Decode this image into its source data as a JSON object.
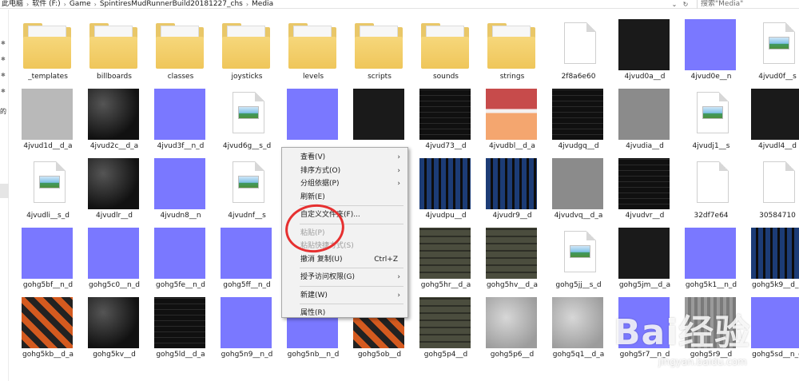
{
  "address_bar": {
    "crumbs": [
      "此电脑",
      "软件 (F:)",
      "Game",
      "SpintiresMudRunnerBuild20181227_chs",
      "Media"
    ],
    "separator": "›",
    "search_placeholder": "搜索\"Media\""
  },
  "nav": {
    "partial_text": "的"
  },
  "files": [
    {
      "name": "_templates",
      "kind": "folder"
    },
    {
      "name": "billboards",
      "kind": "folder"
    },
    {
      "name": "classes",
      "kind": "folder"
    },
    {
      "name": "joysticks",
      "kind": "folder"
    },
    {
      "name": "levels",
      "kind": "folder"
    },
    {
      "name": "scripts",
      "kind": "folder"
    },
    {
      "name": "sounds",
      "kind": "folder"
    },
    {
      "name": "strings",
      "kind": "folder"
    },
    {
      "name": "2f8a6e60",
      "kind": "blank"
    },
    {
      "name": "4jvud0a__d",
      "kind": "dark"
    },
    {
      "name": "4jvud0e__n",
      "kind": "blue"
    },
    {
      "name": "4jvud0f__s",
      "kind": "image"
    },
    {
      "name": "4jvud1d__d_a",
      "kind": "lgray"
    },
    {
      "name": "4jvud2c__d_a",
      "kind": "dark2"
    },
    {
      "name": "4jvud3f__n_d",
      "kind": "blue"
    },
    {
      "name": "4jvud6g__s_d",
      "kind": "image"
    },
    {
      "name": "",
      "kind": "blue"
    },
    {
      "name": "",
      "kind": "dark"
    },
    {
      "name": "4jvud73__d",
      "kind": "dark3"
    },
    {
      "name": "4jvudbl__d_a",
      "kind": "peach"
    },
    {
      "name": "4jvudgq__d",
      "kind": "dark3"
    },
    {
      "name": "4jvudia__d",
      "kind": "gray"
    },
    {
      "name": "4jvudj1__s",
      "kind": "image"
    },
    {
      "name": "4jvudl4__d",
      "kind": "dark"
    },
    {
      "name": "4jvudli__s_d",
      "kind": "image"
    },
    {
      "name": "4jvudlr__d",
      "kind": "dark2"
    },
    {
      "name": "4jvudn8__n",
      "kind": "blue"
    },
    {
      "name": "4jvudnf__s",
      "kind": "image"
    },
    {
      "name": "",
      "kind": "none"
    },
    {
      "name": "",
      "kind": "none"
    },
    {
      "name": "4jvudpu__d",
      "kind": "bluemap"
    },
    {
      "name": "4jvudr9__d",
      "kind": "bluemap"
    },
    {
      "name": "4jvudvq__d_a",
      "kind": "gray"
    },
    {
      "name": "4jvudvr__d",
      "kind": "dark3"
    },
    {
      "name": "32df7e64",
      "kind": "blank"
    },
    {
      "name": "30584710",
      "kind": "blank"
    },
    {
      "name": "gohg5bf__n_d",
      "kind": "blue"
    },
    {
      "name": "gohg5c0__n_d",
      "kind": "blue"
    },
    {
      "name": "gohg5fe__n_d",
      "kind": "blue"
    },
    {
      "name": "gohg5ff__n_d",
      "kind": "blue"
    },
    {
      "name": "",
      "kind": "none"
    },
    {
      "name": "",
      "kind": "none"
    },
    {
      "name": "gohg5hr__d_a",
      "kind": "olive"
    },
    {
      "name": "gohg5hv__d_a",
      "kind": "olive"
    },
    {
      "name": "gohg5jj__s_d",
      "kind": "image"
    },
    {
      "name": "gohg5jm__d_a",
      "kind": "dark"
    },
    {
      "name": "gohg5k1__n_d",
      "kind": "blue"
    },
    {
      "name": "gohg5k9__d_a",
      "kind": "bluemap"
    },
    {
      "name": "gohg5kb__d_a",
      "kind": "orange"
    },
    {
      "name": "gohg5kv__d",
      "kind": "dark2"
    },
    {
      "name": "gohg5ld__d_a",
      "kind": "dark3"
    },
    {
      "name": "gohg5n9__n_d",
      "kind": "blue"
    },
    {
      "name": "gohg5nb__n_d",
      "kind": "blue"
    },
    {
      "name": "gohg5ob__d",
      "kind": "orange"
    },
    {
      "name": "gohg5p4__d",
      "kind": "olive"
    },
    {
      "name": "gohg5p6__d",
      "kind": "stone"
    },
    {
      "name": "gohg5q1__d_a",
      "kind": "stone"
    },
    {
      "name": "gohg5r7__n_d",
      "kind": "blue"
    },
    {
      "name": "gohg5r9__d",
      "kind": "vein"
    },
    {
      "name": "gohg5sd__n_d",
      "kind": "blue"
    }
  ],
  "context_menu": {
    "items": [
      {
        "label": "查看(V)",
        "submenu": true,
        "disabled": false
      },
      {
        "label": "排序方式(O)",
        "submenu": true,
        "disabled": false
      },
      {
        "label": "分组依据(P)",
        "submenu": true,
        "disabled": false
      },
      {
        "label": "刷新(E)",
        "submenu": false,
        "disabled": false
      },
      {
        "sep": true
      },
      {
        "label": "自定义文件夹(F)...",
        "submenu": false,
        "disabled": false
      },
      {
        "sep": true
      },
      {
        "label": "粘贴(P)",
        "submenu": false,
        "disabled": true
      },
      {
        "label": "粘贴快捷方式(S)",
        "submenu": false,
        "disabled": true
      },
      {
        "label": "撤消 复制(U)",
        "shortcut": "Ctrl+Z",
        "submenu": false,
        "disabled": false
      },
      {
        "sep": true
      },
      {
        "label": "授予访问权限(G)",
        "submenu": true,
        "disabled": false
      },
      {
        "sep": true
      },
      {
        "label": "新建(W)",
        "submenu": true,
        "disabled": false
      },
      {
        "sep": true
      },
      {
        "label": "属性(R)",
        "submenu": false,
        "disabled": false
      }
    ]
  },
  "watermark": {
    "brand": "Bai经验",
    "url": "jingyan.baidu.com"
  }
}
